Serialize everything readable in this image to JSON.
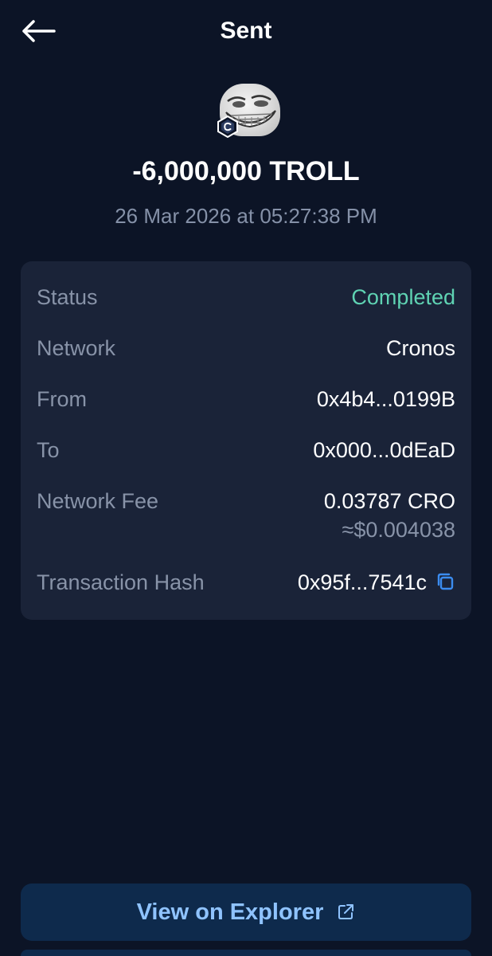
{
  "header": {
    "title": "Sent",
    "back_icon": "arrow-left-icon"
  },
  "token": {
    "icon": "troll-face-token-icon",
    "chain_badge_icon": "cronos-chain-icon"
  },
  "transaction": {
    "amount": "-6,000,000 TROLL",
    "datetime": "26 Mar 2026 at 05:27:38 PM"
  },
  "details": {
    "status_label": "Status",
    "status_value": "Completed",
    "network_label": "Network",
    "network_value": "Cronos",
    "from_label": "From",
    "from_value": "0x4b4...0199B",
    "to_label": "To",
    "to_value": "0x000...0dEaD",
    "fee_label": "Network Fee",
    "fee_value": "0.03787 CRO",
    "fee_usd": "≈$0.004038",
    "hash_label": "Transaction Hash",
    "hash_value": "0x95f...7541c",
    "copy_icon": "copy-icon"
  },
  "actions": {
    "explorer_label": "View on Explorer",
    "external_icon": "external-link-icon"
  },
  "colors": {
    "background": "#0c1426",
    "card": "#1a2338",
    "status_green": "#5fd3b3",
    "accent_blue": "#8fc3ff",
    "copy_blue": "#3b8cf0"
  }
}
